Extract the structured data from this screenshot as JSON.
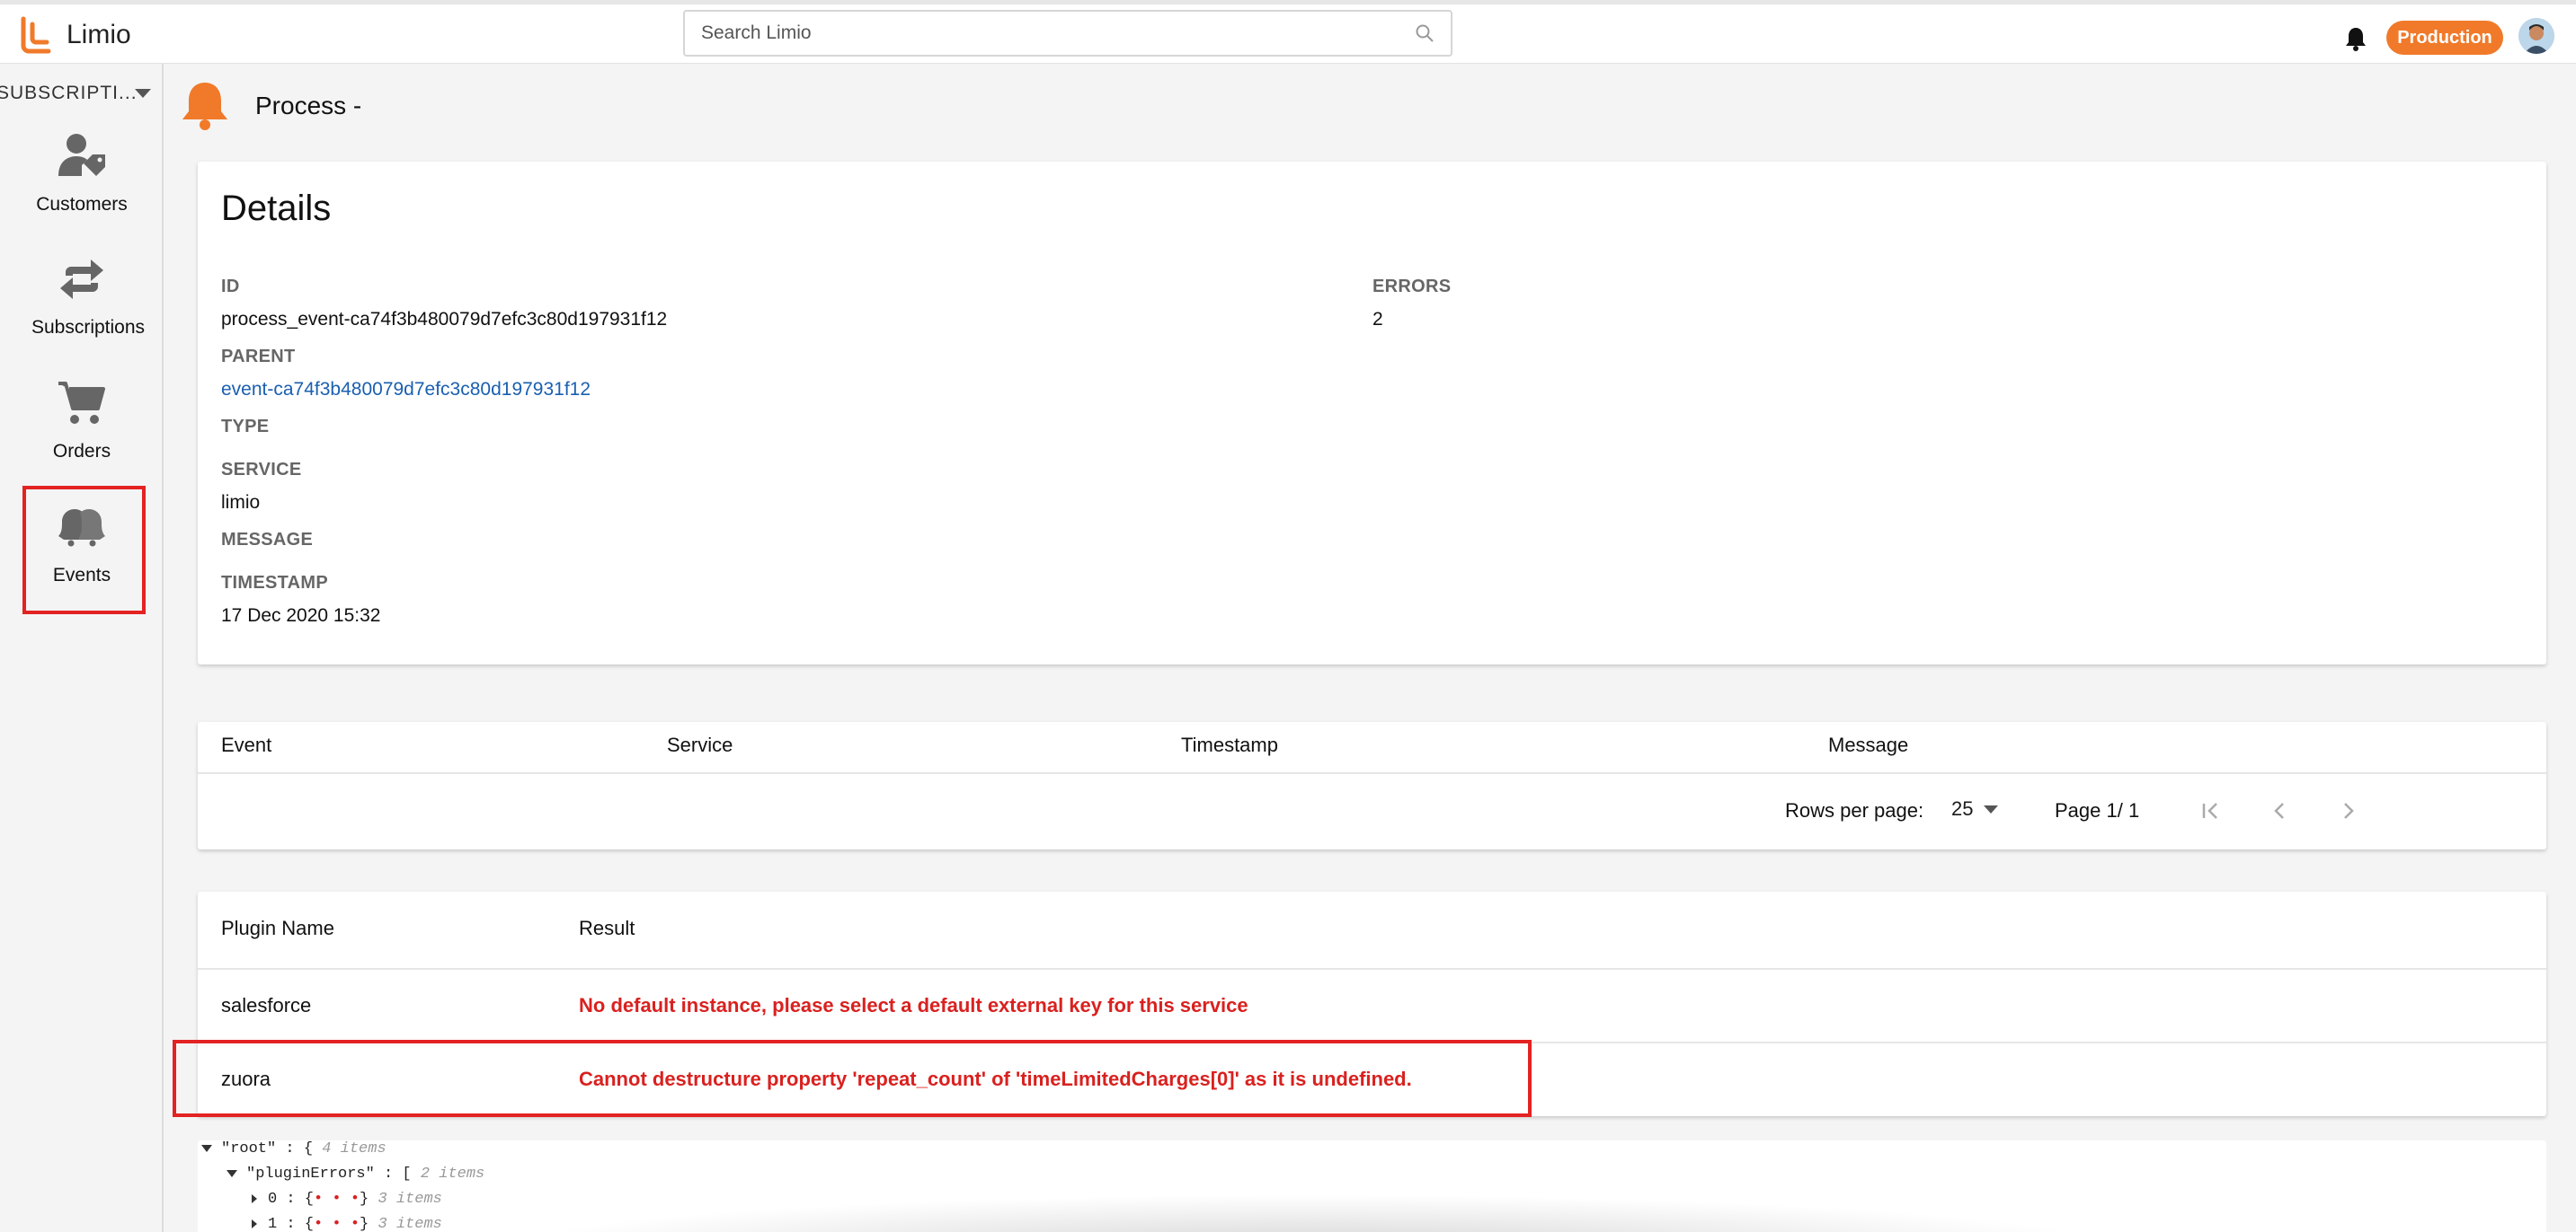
{
  "app": {
    "name": "Limio"
  },
  "search": {
    "placeholder": "Search Limio"
  },
  "env_badge": "Production",
  "sidebar": {
    "dropdown_label": "SUBSCRIPTI...",
    "items": [
      {
        "label": "Customers",
        "icon": "customer-icon"
      },
      {
        "label": "Subscriptions",
        "icon": "subscriptions-icon"
      },
      {
        "label": "Orders",
        "icon": "cart-icon"
      },
      {
        "label": "Events",
        "icon": "bells-icon",
        "selected": true
      }
    ]
  },
  "page": {
    "title": "Process -"
  },
  "details": {
    "title": "Details",
    "id_label": "ID",
    "id_value": "process_event-ca74f3b480079d7efc3c80d197931f12",
    "parent_label": "PARENT",
    "parent_value": "event-ca74f3b480079d7efc3c80d197931f12",
    "type_label": "TYPE",
    "service_label": "SERVICE",
    "service_value": "limio",
    "message_label": "MESSAGE",
    "timestamp_label": "TIMESTAMP",
    "timestamp_value": "17 Dec 2020 15:32",
    "errors_label": "ERRORS",
    "errors_value": "2"
  },
  "events_table": {
    "columns": [
      "Event",
      "Service",
      "Timestamp",
      "Message"
    ],
    "rows_per_page_label": "Rows per page:",
    "rows_per_page_value": "25",
    "page_label": "Page 1/ 1"
  },
  "plugins_table": {
    "columns": [
      "Plugin Name",
      "Result"
    ],
    "rows": [
      {
        "name": "salesforce",
        "result": "No default instance, please select a default external key for this service"
      },
      {
        "name": "zuora",
        "result": "Cannot destructure property 'repeat_count' of 'timeLimitedCharges[0]' as it is undefined."
      }
    ]
  },
  "json_viewer": {
    "root_key": "\"root\"",
    "root_open": ": {",
    "root_meta": "4 items",
    "errors_key": "\"pluginErrors\"",
    "errors_open": ": [",
    "errors_meta": "2 items",
    "item0_key": "0",
    "item0_meta": "3 items",
    "item1_key": "1",
    "item1_meta": "3 items"
  },
  "colors": {
    "accent": "#f07a2a",
    "error": "#d9211f",
    "link": "#1a5fb0",
    "highlight": "#e32222"
  }
}
